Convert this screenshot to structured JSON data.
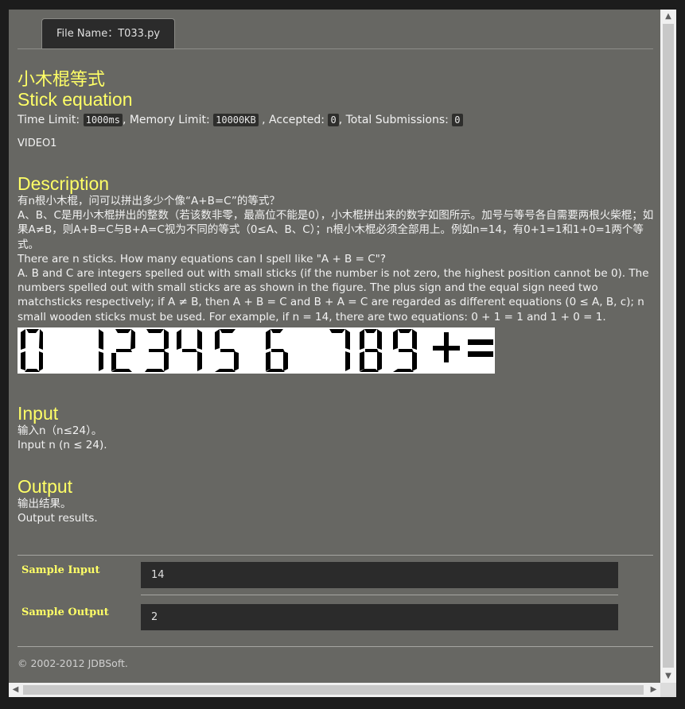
{
  "tab": {
    "label": "File Name：T033.py"
  },
  "problem": {
    "title_cn": "小木棍等式",
    "title_en": "Stick equation",
    "time_limit_label": "Time Limit:",
    "time_limit_value": "1000ms",
    "memory_limit_label": ", Memory Limit:",
    "memory_limit_value": "10000KB",
    "accepted_label": ", Accepted:",
    "accepted_value": "0",
    "total_submissions_label": ", Total Submissions:",
    "total_submissions_value": "0",
    "video": "VIDEO1"
  },
  "description": {
    "heading": "Description",
    "cn_1": "有n根小木棍，问可以拼出多少个像“A+B=C”的等式？",
    "cn_2": "A、B、C是用小木棍拼出的整数（若该数非零，最高位不能是0），小木棍拼出来的数字如图所示。加号与等号各自需要两根火柴棍；如果A≠B，则A+B=C与B+A=C视为不同的等式（0≤A、B、C）；n根小木棍必须全部用上。例如n=14，有0+1=1和1+0=1两个等式。",
    "en_1": "There are n sticks. How many equations can I spell like \"A + B = C\"?",
    "en_2": "A. B and C are integers spelled out with small sticks (if the number is not zero, the highest position cannot be 0). The numbers spelled out with small sticks are as shown in the figure. The plus sign and the equal sign need two matchsticks respectively; if A ≠ B, then A + B = C and B + A = C are regarded as different equations (0 ≤ A, B, c); n small wooden sticks must be used. For example, if n = 14, there are two equations: 0 + 1 = 1 and 1 + 0 = 1."
  },
  "input": {
    "heading": "Input",
    "cn": "输入n（n≤24）。",
    "en": "Input n (n ≤ 24)."
  },
  "output": {
    "heading": "Output",
    "cn": "输出结果。",
    "en": "Output results."
  },
  "sample": {
    "input_label": "Sample Input",
    "input_value": "14",
    "output_label": "Sample Output",
    "output_value": "2"
  },
  "footer": "© 2002-2012  JDBSoft."
}
